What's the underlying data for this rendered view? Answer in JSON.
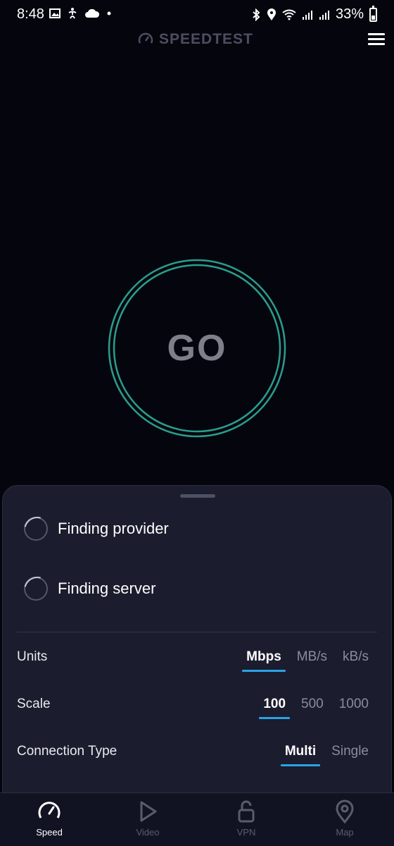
{
  "status_bar": {
    "time": "8:48",
    "battery_text": "33%",
    "battery_level": 0.33,
    "left_icons": [
      "image-icon",
      "accessibility-icon",
      "cloud-icon",
      "dot-icon"
    ],
    "right_icons": [
      "bluetooth-icon",
      "location-icon",
      "wifi-icon",
      "signal-icon",
      "signal-icon"
    ]
  },
  "header": {
    "logo_text": "SPEEDTEST",
    "logo_icon": "speedometer-icon",
    "menu_icon": "hamburger-menu-icon"
  },
  "main": {
    "go_label": "GO",
    "ring_color": "#2a9d8f"
  },
  "sheet": {
    "steps": [
      {
        "label": "Finding provider"
      },
      {
        "label": "Finding server"
      }
    ],
    "settings": {
      "units": {
        "label": "Units",
        "options": [
          "Mbps",
          "MB/s",
          "kB/s"
        ],
        "selected": "Mbps"
      },
      "scale": {
        "label": "Scale",
        "options": [
          "100",
          "500",
          "1000"
        ],
        "selected": "100"
      },
      "connection": {
        "label": "Connection Type",
        "options": [
          "Multi",
          "Single"
        ],
        "selected": "Multi"
      }
    }
  },
  "bottom_nav": {
    "items": [
      {
        "label": "Speed",
        "icon": "speedometer-icon",
        "active": true
      },
      {
        "label": "Video",
        "icon": "play-icon",
        "active": false
      },
      {
        "label": "VPN",
        "icon": "unlock-icon",
        "active": false
      },
      {
        "label": "Map",
        "icon": "map-pin-icon",
        "active": false
      }
    ]
  },
  "colors": {
    "background": "#05060d",
    "sheet": "#1b1c2e",
    "accent": "#29a3e6",
    "go_ring": "#2a9d8f"
  }
}
